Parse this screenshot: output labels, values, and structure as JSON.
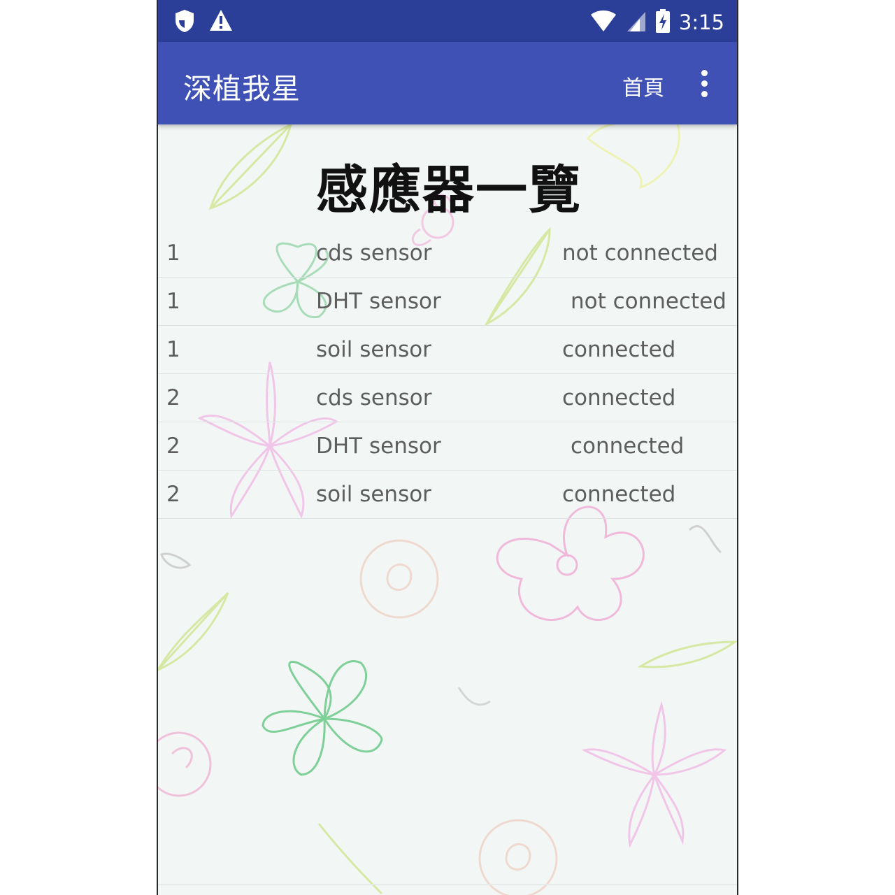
{
  "status_bar": {
    "time": "3:15",
    "left_icons": [
      "shield-icon",
      "warning-icon"
    ],
    "right_icons": [
      "wifi-icon",
      "signal-icon",
      "battery-charging-icon"
    ]
  },
  "app_bar": {
    "title": "深植我星",
    "home_label": "首頁",
    "overflow_icon": "more-vert-icon"
  },
  "page": {
    "title": "感應器一覽"
  },
  "sensors": [
    {
      "id": "1",
      "name": "cds sensor",
      "status": "not connected"
    },
    {
      "id": "1",
      "name": "DHT sensor",
      "status": "not connected"
    },
    {
      "id": "1",
      "name": "soil sensor",
      "status": "connected"
    },
    {
      "id": "2",
      "name": "cds sensor",
      "status": "connected"
    },
    {
      "id": "2",
      "name": "DHT sensor",
      "status": "connected"
    },
    {
      "id": "2",
      "name": "soil sensor",
      "status": "connected"
    }
  ],
  "colors": {
    "status_bar": "#2b3f99",
    "app_bar": "#3f51b5",
    "background": "#f2f7f6",
    "row_text": "#5d5d5d"
  }
}
